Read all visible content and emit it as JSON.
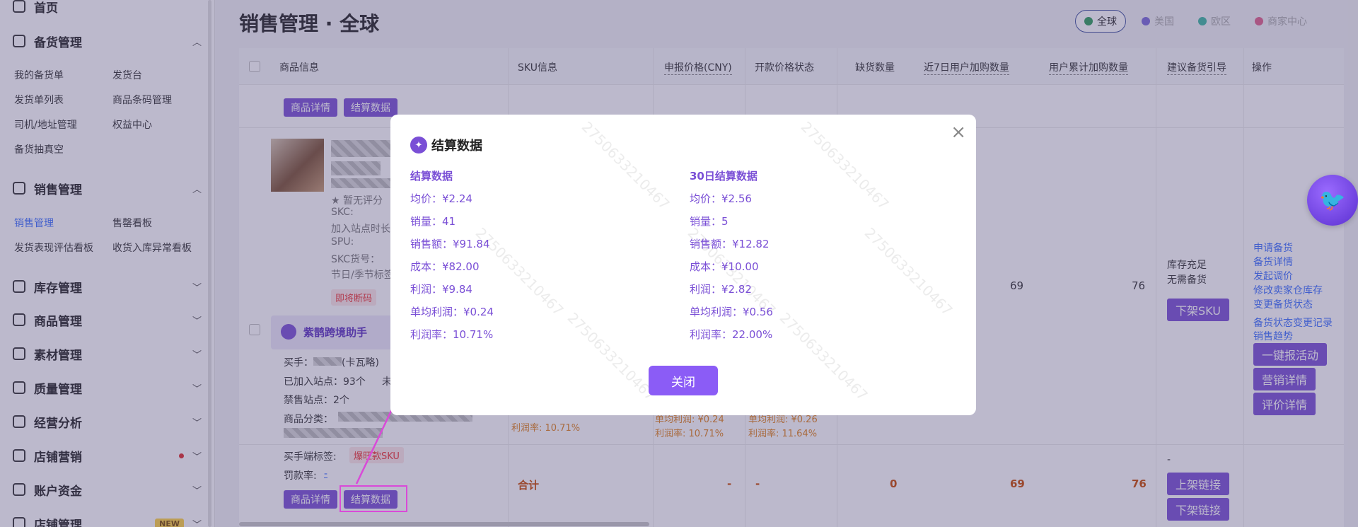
{
  "sidebar": {
    "home": "首页",
    "g_stock": "备货管理",
    "stock_items": [
      "我的备货单",
      "发货台",
      "发货单列表",
      "商品条码管理",
      "司机/地址管理",
      "权益中心",
      "备货抽真空"
    ],
    "g_sales": "销售管理",
    "sales_items": [
      "销售管理",
      "售罄看板",
      "发货表现评估看板",
      "收货入库异常看板"
    ],
    "g_inventory": "库存管理",
    "g_goods": "商品管理",
    "g_material": "素材管理",
    "g_quality": "质量管理",
    "g_analysis": "经营分析",
    "g_marketing": "店铺营销",
    "g_account": "账户资金",
    "g_store": "店铺管理",
    "new_badge": "NEW"
  },
  "header": {
    "title": "销售管理 · 全球",
    "regions": [
      {
        "label": "全球",
        "color": "#2e9d5a"
      },
      {
        "label": "美国",
        "color": "#7a6ad8"
      },
      {
        "label": "欧区",
        "color": "#3cb6a0"
      },
      {
        "label": "商家中心",
        "color": "#e0608a"
      }
    ]
  },
  "table": {
    "headers": [
      "商品信息",
      "SKU信息",
      "申报价格(CNY)",
      "开款价格状态",
      "缺货数量",
      "近7日用户加购数量",
      "用户累计加购数量",
      "建议备货引导",
      "操作"
    ],
    "btn_detail": "商品详情",
    "btn_settle": "结算数据",
    "no_rating": "暂无评分",
    "skc_label": "SKC:",
    "joined_duration": "加入站点时长",
    "spu_label": "SPU:",
    "skc_no": "SKC货号：",
    "season_tag": "节日/季节标签",
    "soon_out": "即将断码",
    "stock_ok": "库存充足",
    "no_need": "无需备货",
    "btn_off_sku": "下架SKU",
    "num_69": "69",
    "num_76": "76",
    "actions": [
      "申请备货",
      "备货详情",
      "发起调价",
      "修改卖家仓库存",
      "变更备货状态",
      "备货状态变更记录",
      "销售趋势"
    ],
    "btn_activity": "一键报活动",
    "btn_marketing": "营销详情",
    "btn_review": "评价详情",
    "panel_title": "紫鹊跨境助手",
    "buyer": "买手：",
    "buyer_name": "(卡瓦略)",
    "joined_sites": "已加入站点：93个",
    "unjoined": "未",
    "banned_sites": "禁售站点：2个",
    "category": "商品分类：",
    "buyer_tag": "买手端标签:",
    "hot_sku": "爆旺款SKU",
    "penalty": "罚款率:",
    "penalty_val": "-",
    "profit_rate_a": "利润率: 10.71%",
    "unit_profit_b": "单均利润: ¥0.24",
    "profit_rate_b": "利润率: 10.71%",
    "unit_profit_c": "单均利润: ¥0.26",
    "profit_rate_c": "利润率: 11.64%",
    "total": "合计",
    "dash": "-",
    "zero": "0",
    "btn_on_link": "上架链接",
    "btn_off_link": "下架链接"
  },
  "modal": {
    "title": "结算数据",
    "close_x": "×",
    "watermark": "2750633210467",
    "left": {
      "heading": "结算数据",
      "lines": [
        "均价：¥2.24",
        "销量：41",
        "销售额：¥91.84",
        "成本：¥82.00",
        "利润：¥9.84",
        "单均利润：¥0.24",
        "利润率：10.71%"
      ]
    },
    "right": {
      "heading": "30日结算数据",
      "lines": [
        "均价：¥2.56",
        "销量：5",
        "销售额：¥12.82",
        "成本：¥10.00",
        "利润：¥2.82",
        "单均利润：¥0.56",
        "利润率：22.00%"
      ]
    },
    "close_button": "关闭"
  }
}
